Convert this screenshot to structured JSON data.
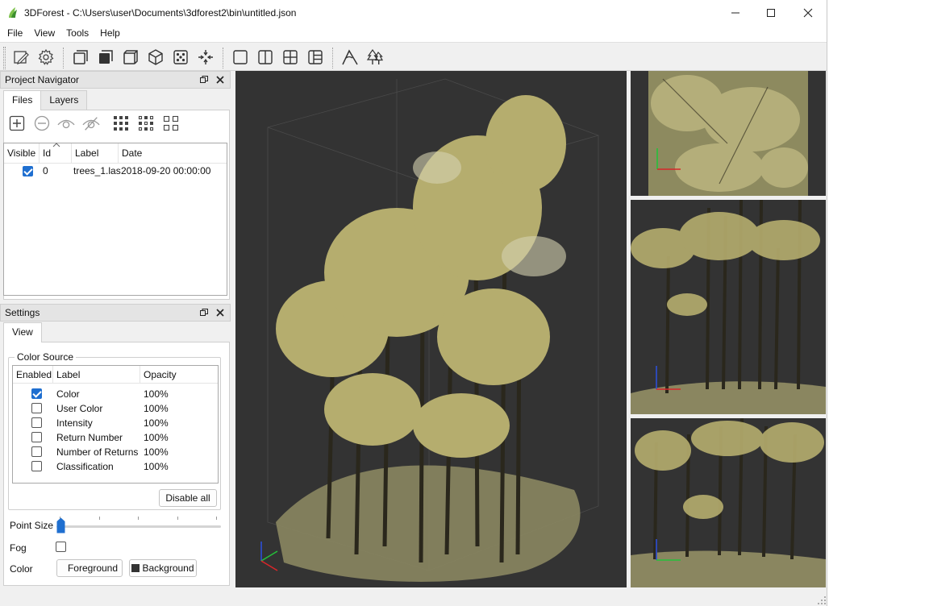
{
  "window": {
    "title": "3DForest - C:\\Users\\user\\Documents\\3dforest2\\bin\\untitled.json"
  },
  "menu": [
    "File",
    "View",
    "Tools",
    "Help"
  ],
  "toolbar": {
    "buttons": [
      "edit-icon",
      "settings-gear-icon",
      "view-front-icon",
      "view-back-icon",
      "view-side-icon",
      "view-3d-cube-icon",
      "view-fit-icon",
      "view-reset-icon",
      "layout-single-icon",
      "layout-two-columns-icon",
      "layout-grid-icon",
      "layout-three-icon",
      "measure-tool-icon",
      "tree-segmentation-icon"
    ]
  },
  "project_navigator": {
    "title": "Project Navigator",
    "tabs": [
      {
        "label": "Files",
        "active": true
      },
      {
        "label": "Layers",
        "active": false
      }
    ],
    "columns": [
      "Visible",
      "Id",
      "Label",
      "Date"
    ],
    "files": [
      {
        "visible": true,
        "id": "0",
        "label": "trees_1.las",
        "date": "2018-09-20 00:00:00"
      }
    ]
  },
  "settings": {
    "title": "Settings",
    "tabs": [
      {
        "label": "View",
        "active": true
      }
    ],
    "color_source": {
      "label": "Color Source",
      "columns": [
        "Enabled",
        "Label",
        "Opacity"
      ],
      "rows": [
        {
          "enabled": true,
          "label": "Color",
          "opacity": "100%"
        },
        {
          "enabled": false,
          "label": "User Color",
          "opacity": "100%"
        },
        {
          "enabled": false,
          "label": "Intensity",
          "opacity": "100%"
        },
        {
          "enabled": false,
          "label": "Return Number",
          "opacity": "100%"
        },
        {
          "enabled": false,
          "label": "Number of Returns",
          "opacity": "100%"
        },
        {
          "enabled": false,
          "label": "Classification",
          "opacity": "100%"
        }
      ],
      "disable_all_label": "Disable all"
    },
    "point_size_label": "Point Size",
    "point_size_value": 0,
    "fog_label": "Fog",
    "fog_enabled": false,
    "color_label": "Color",
    "foreground_label": "Foreground",
    "background_label": "Background"
  },
  "colors": {
    "viewport_bg": "#333333",
    "accent": "#1f6fd0",
    "foliage": "#b9b27a"
  }
}
